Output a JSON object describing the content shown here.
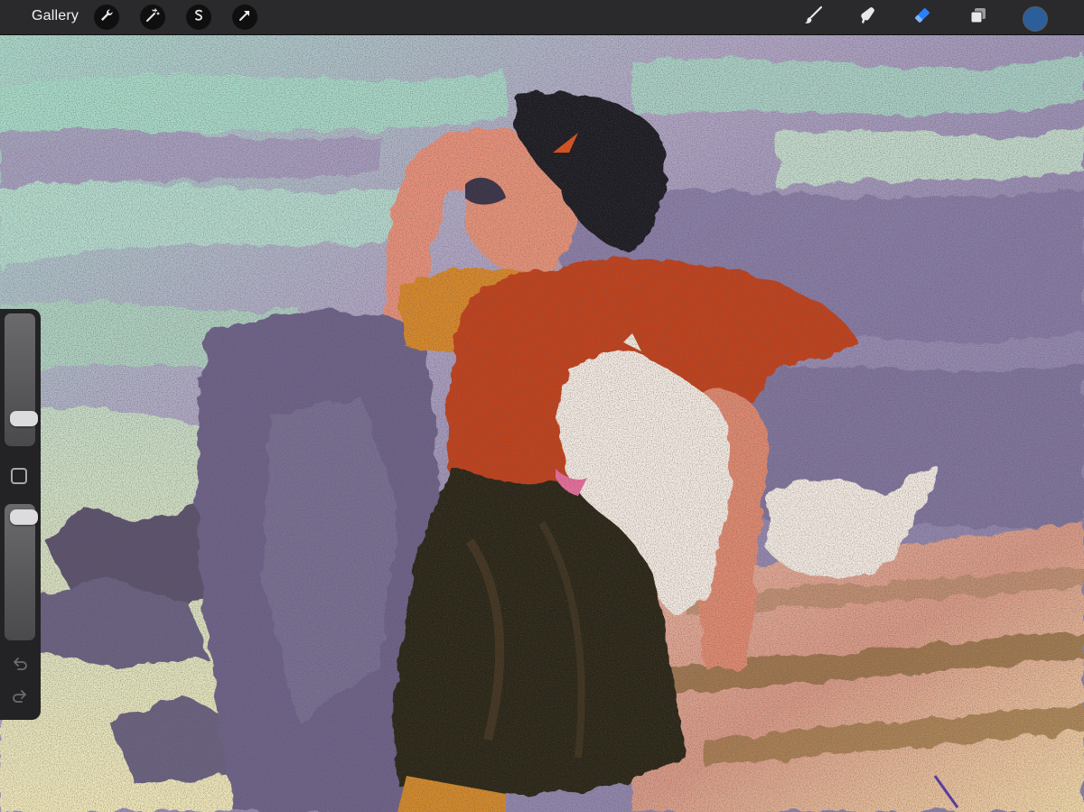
{
  "toolbar": {
    "gallery_label": "Gallery",
    "left_tools": [
      "wrench-icon",
      "magic-wand-icon",
      "selection-icon",
      "transform-arrow-icon"
    ],
    "right_tools": [
      "brush-icon",
      "smudge-icon",
      "eraser-icon",
      "layers-icon"
    ],
    "active_tool": "eraser-icon",
    "active_color": "#2c5f9a",
    "accent_color": "#2b7ff7"
  },
  "sidebar": {
    "size_slider_level": 0.85,
    "opacity_slider_level": 0.02,
    "controls": [
      "size-slider",
      "modify-button",
      "opacity-slider",
      "undo-icon",
      "redo-icon"
    ]
  },
  "canvas": {
    "palette": {
      "sky_mint": "#a8d8c8",
      "sky_lavender": "#9a8fb4",
      "cliff_purple": "#6f6590",
      "skin": "#e8957a",
      "shirt_red": "#c0421c",
      "shirt_orange": "#d98a2a",
      "pants_dark": "#2c2418",
      "hair": "#1e1a1e",
      "goat_white": "#f4ece4",
      "ground_pink": "#e6a894",
      "ground_cream": "#f0e0b0"
    }
  }
}
